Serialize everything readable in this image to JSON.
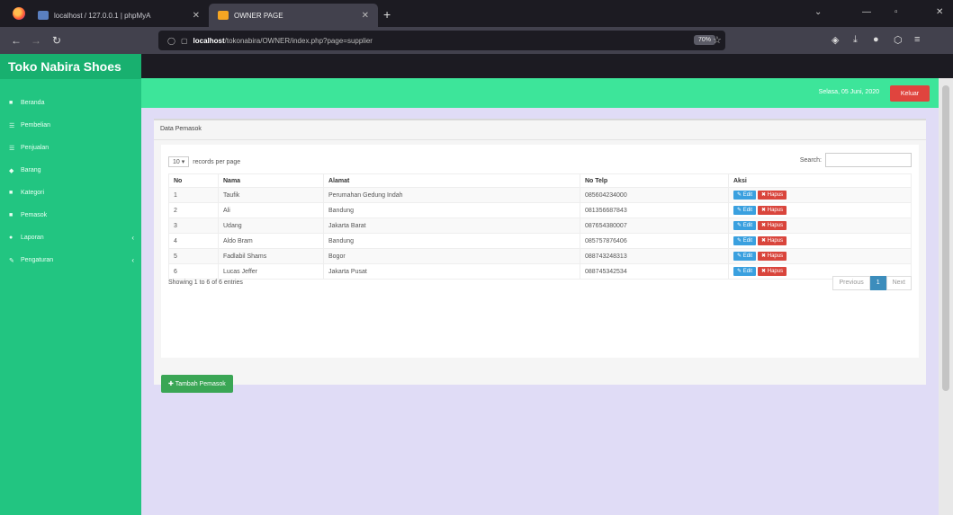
{
  "browser": {
    "tabs": [
      {
        "title": "localhost / 127.0.0.1 | phpMyA"
      },
      {
        "title": "OWNER PAGE"
      }
    ],
    "url_host": "localhost",
    "url_path": "/tokonabira/OWNER/index.php?page=supplier",
    "zoom": "70%"
  },
  "sidebar": {
    "brand": "Toko Nabira Shoes",
    "items": [
      {
        "label": "Beranda",
        "icon": "home-icon"
      },
      {
        "label": "Pembelian",
        "icon": "list-icon"
      },
      {
        "label": "Penjualan",
        "icon": "list-icon"
      },
      {
        "label": "Barang",
        "icon": "tag-icon"
      },
      {
        "label": "Kategori",
        "icon": "folder-icon"
      },
      {
        "label": "Pemasok",
        "icon": "truck-icon"
      },
      {
        "label": "Laporan",
        "icon": "file-icon",
        "has_children": true
      },
      {
        "label": "Pengaturan",
        "icon": "wrench-icon",
        "has_children": true
      }
    ]
  },
  "topbar": {
    "date": "Selasa, 05 Juni, 2020",
    "logout_label": "Keluar"
  },
  "panel": {
    "title": "Data Pemasok",
    "length_value": "10",
    "length_label": "records per page",
    "search_label": "Search:",
    "columns": [
      "No",
      "Nama",
      "Alamat",
      "No Telp",
      "Aksi"
    ],
    "rows": [
      {
        "no": "1",
        "nama": "Taufik",
        "alamat": "Perumahan Gedung Indah",
        "telp": "085604234000"
      },
      {
        "no": "2",
        "nama": "Ali",
        "alamat": "Bandung",
        "telp": "081356687843"
      },
      {
        "no": "3",
        "nama": "Udang",
        "alamat": "Jakarta Barat",
        "telp": "087654380007"
      },
      {
        "no": "4",
        "nama": "Aldo Bram",
        "alamat": "Bandung",
        "telp": "085757876406"
      },
      {
        "no": "5",
        "nama": "Fadlabil Shams",
        "alamat": "Bogor",
        "telp": "088743248313"
      },
      {
        "no": "6",
        "nama": "Lucas Jeffer",
        "alamat": "Jakarta Pusat",
        "telp": "088745342534"
      }
    ],
    "edit_label": "Edit",
    "delete_label": "Hapus",
    "info": "Showing 1 to 6 of 6 entries",
    "pager": {
      "prev": "Previous",
      "current": "1",
      "next": "Next"
    },
    "add_label": "Tambah Pemasok"
  }
}
